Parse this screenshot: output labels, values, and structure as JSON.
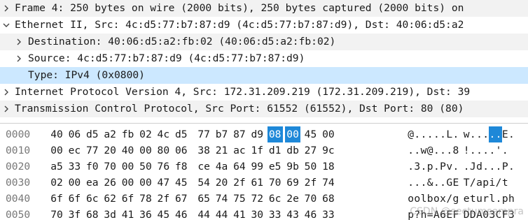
{
  "tree": [
    {
      "label": "Frame 4: 250 bytes on wire (2000 bits), 250 bytes captured (2000 bits) on",
      "state": "collapsed",
      "indent": 0
    },
    {
      "label": "Ethernet II, Src: 4c:d5:77:b7:87:d9 (4c:d5:77:b7:87:d9), Dst: 40:06:d5:a2",
      "state": "expanded",
      "indent": 0
    },
    {
      "label": "Destination: 40:06:d5:a2:fb:02 (40:06:d5:a2:fb:02)",
      "state": "collapsed",
      "indent": 1
    },
    {
      "label": "Source: 4c:d5:77:b7:87:d9 (4c:d5:77:b7:87:d9)",
      "state": "collapsed",
      "indent": 1
    },
    {
      "label": "Type: IPv4 (0x0800)",
      "state": "leaf",
      "indent": 1,
      "selected": true
    },
    {
      "label": "Internet Protocol Version 4, Src: 172.31.209.219 (172.31.209.219), Dst: 39",
      "state": "collapsed",
      "indent": 0
    },
    {
      "label": "Transmission Control Protocol, Src Port: 61552 (61552), Dst Port: 80 (80)",
      "state": "collapsed",
      "indent": 0
    }
  ],
  "hex_rows": [
    {
      "offset": "0000",
      "bytes": [
        "40",
        "06",
        "d5",
        "a2",
        "fb",
        "02",
        "4c",
        "d5",
        "77",
        "b7",
        "87",
        "d9",
        "08",
        "00",
        "45",
        "00"
      ],
      "ascii": "@.....L. w.....E."
    },
    {
      "offset": "0010",
      "bytes": [
        "00",
        "ec",
        "77",
        "20",
        "40",
        "00",
        "80",
        "06",
        "38",
        "21",
        "ac",
        "1f",
        "d1",
        "db",
        "27",
        "9c"
      ],
      "ascii": "..w @... 8!....'."
    },
    {
      "offset": "0020",
      "bytes": [
        "a5",
        "33",
        "f0",
        "70",
        "00",
        "50",
        "76",
        "f8",
        "ce",
        "4a",
        "64",
        "99",
        "e5",
        "9b",
        "50",
        "18"
      ],
      "ascii": ".3.p.Pv. .Jd...P."
    },
    {
      "offset": "0030",
      "bytes": [
        "02",
        "00",
        "ea",
        "26",
        "00",
        "00",
        "47",
        "45",
        "54",
        "20",
        "2f",
        "61",
        "70",
        "69",
        "2f",
        "74"
      ],
      "ascii": "...&..GE T /api/t"
    },
    {
      "offset": "0040",
      "bytes": [
        "6f",
        "6f",
        "6c",
        "62",
        "6f",
        "78",
        "2f",
        "67",
        "65",
        "74",
        "75",
        "72",
        "6c",
        "2e",
        "70",
        "68"
      ],
      "ascii": "oolbox/g eturl.ph"
    },
    {
      "offset": "0050",
      "bytes": [
        "70",
        "3f",
        "68",
        "3d",
        "41",
        "36",
        "45",
        "46",
        "44",
        "44",
        "41",
        "30",
        "33",
        "43",
        "46",
        "33"
      ],
      "ascii": "p?h=A6EF DDA03CF3"
    }
  ],
  "highlight": {
    "row": 0,
    "start": 12,
    "end": 13
  },
  "watermark": "CSDN @sectumsempra",
  "colors": {
    "selection": "#cce8ff",
    "highlight": "#1e88d8",
    "alt_row": "#f2f2f2"
  }
}
